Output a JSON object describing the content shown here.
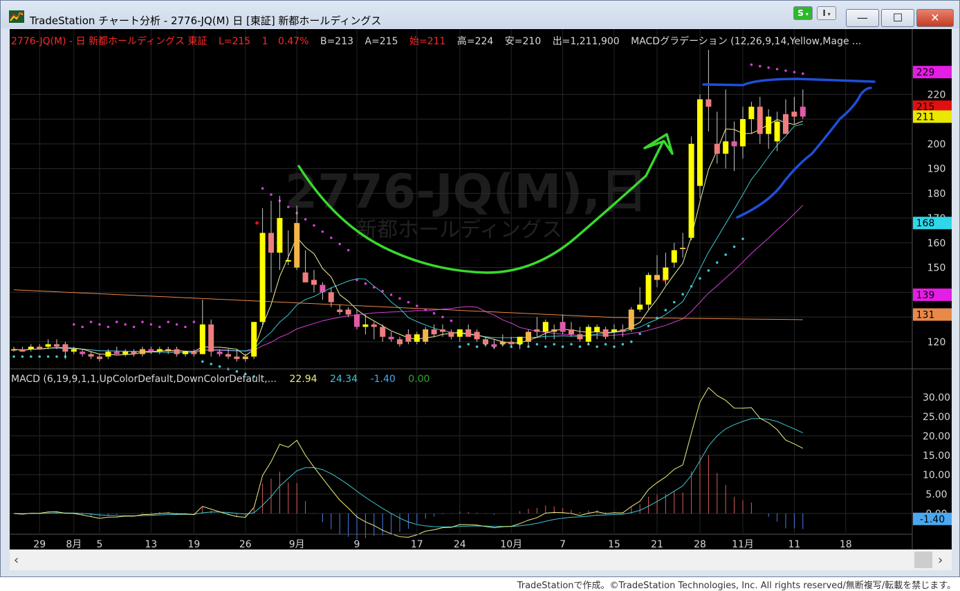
{
  "window": {
    "title": "TradeStation チャート分析 - 2776-JQ(M) 日 [東証] 新都ホールディングス",
    "btn_s": "S",
    "btn_i": "I",
    "min_glyph": "—",
    "max_glyph": "☐",
    "close_glyph": "✕"
  },
  "colors": {
    "background": "#000000",
    "bull": "#ffff00",
    "bull_alt": "#f4b64b",
    "bear": "#ef7d7d",
    "bear_alt": "#e05aa8",
    "ma_fast": "#f5f5a0",
    "ma_mid": "#3fc8d4",
    "ma_slow": "#d63fd6",
    "ma_long": "#e8894a",
    "macd": "#f0f080",
    "signal": "#3fc8d4",
    "annot_green": "#39d82e",
    "annot_blue": "#1f4fd8"
  },
  "info_bar": {
    "symbol": "2776-JQ(M) - 日  新都ホールディングス  東証",
    "last": "L=215",
    "change": "1",
    "pct": "0.47%",
    "bid": "B=213",
    "ask": "A=215",
    "open": "始=211",
    "high": "高=224",
    "low": "安=210",
    "volume": "出=1,211,900",
    "study": "MACDグラデーション (12,26,9,14,Yellow,Mage ..."
  },
  "watermark": {
    "symbol": "2776-JQ(M),日",
    "name": "新都ホールディングス"
  },
  "macd_info": {
    "label": "MACD (6,19,9,1,1,UpColorDefault,DownColorDefault,...",
    "macd": "22.94",
    "signal": "24.34",
    "hist": "-1.40",
    "zero": "0.00"
  },
  "price_badges": [
    {
      "value": "229",
      "bg": "#e41ee4",
      "fg": "#000000"
    },
    {
      "value": "215",
      "bg": "#e01010",
      "fg": "#000000"
    },
    {
      "value": "211",
      "bg": "#e8e800",
      "fg": "#000000"
    },
    {
      "value": "168",
      "bg": "#2fd8e8",
      "fg": "#000000"
    },
    {
      "value": "139",
      "bg": "#e41ee4",
      "fg": "#000000"
    },
    {
      "value": "131",
      "bg": "#e8894a",
      "fg": "#000000"
    }
  ],
  "macd_badge": {
    "value": "-1.40",
    "bg": "#4aa8f0",
    "fg": "#000000"
  },
  "chart_data": {
    "type": "candlestick",
    "price_axis": {
      "ticks": [
        120,
        130,
        140,
        150,
        160,
        170,
        180,
        190,
        200,
        210,
        220
      ],
      "ylim": [
        111,
        238
      ]
    },
    "macd_axis": {
      "ticks": [
        0,
        5,
        10,
        15,
        20,
        25,
        30
      ],
      "tick_labels": [
        "0.00",
        "5.00",
        "10.00",
        "15.00",
        "20.00",
        "25.00",
        "30.00"
      ],
      "ylim": [
        -5,
        33
      ]
    },
    "x_labels": [
      "29",
      "8月",
      "5",
      "13",
      "19",
      "26",
      "9月",
      "9",
      "17",
      "24",
      "10月",
      "7",
      "15",
      "21",
      "28",
      "11月",
      "11",
      "18"
    ],
    "candles": [
      [
        117,
        118,
        116,
        117
      ],
      [
        117,
        118,
        116,
        116
      ],
      [
        117,
        119,
        116,
        118
      ],
      [
        118,
        119,
        117,
        117
      ],
      [
        118,
        121,
        117,
        119
      ],
      [
        119,
        121,
        117,
        118
      ],
      [
        119,
        120,
        113,
        116
      ],
      [
        116,
        118,
        115,
        117
      ],
      [
        116,
        117,
        114,
        115
      ],
      [
        115,
        116,
        113,
        114
      ],
      [
        114,
        115,
        112,
        113
      ],
      [
        114,
        117,
        113,
        116
      ],
      [
        116,
        118,
        115,
        115
      ],
      [
        115,
        117,
        114,
        116
      ],
      [
        116,
        117,
        114,
        115
      ],
      [
        115,
        118,
        114,
        117
      ],
      [
        117,
        118,
        115,
        116
      ],
      [
        116,
        118,
        115,
        117
      ],
      [
        117,
        118,
        115,
        117
      ],
      [
        117,
        118,
        114,
        115
      ],
      [
        115,
        116,
        114,
        116
      ],
      [
        116,
        117,
        114,
        115
      ],
      [
        115,
        137,
        115,
        127
      ],
      [
        127,
        129,
        114,
        116
      ],
      [
        116,
        117,
        114,
        115
      ],
      [
        115,
        117,
        113,
        114
      ],
      [
        114,
        117,
        112,
        113
      ],
      [
        113,
        115,
        112,
        114
      ],
      [
        114,
        128,
        113,
        128
      ],
      [
        128,
        174,
        126,
        164
      ],
      [
        164,
        177,
        140,
        156
      ],
      [
        156,
        179,
        149,
        170
      ],
      [
        153,
        165,
        151,
        153
      ],
      [
        150,
        175,
        149,
        168
      ],
      [
        148,
        157,
        145,
        144
      ],
      [
        145,
        149,
        140,
        143
      ],
      [
        143,
        144,
        137,
        140
      ],
      [
        140,
        142,
        134,
        136
      ],
      [
        133,
        135,
        131,
        132
      ],
      [
        133,
        134,
        130,
        131
      ],
      [
        131,
        133,
        125,
        126
      ],
      [
        126,
        131,
        123,
        127
      ],
      [
        127,
        128,
        121,
        126
      ],
      [
        126,
        127,
        120,
        122
      ],
      [
        122,
        124,
        120,
        121
      ],
      [
        121,
        122,
        118,
        119
      ],
      [
        123,
        125,
        119,
        120
      ],
      [
        120,
        124,
        119,
        123
      ],
      [
        120,
        126,
        119,
        125
      ],
      [
        125,
        127,
        122,
        123
      ],
      [
        125,
        127,
        122,
        124
      ],
      [
        124,
        125,
        121,
        122
      ],
      [
        122,
        125,
        120,
        125
      ],
      [
        125,
        127,
        122,
        122
      ],
      [
        124,
        125,
        120,
        121
      ],
      [
        121,
        122,
        118,
        119
      ],
      [
        119,
        121,
        117,
        118
      ],
      [
        119,
        123,
        118,
        120
      ],
      [
        120,
        122,
        118,
        119
      ],
      [
        119,
        122,
        117,
        122
      ],
      [
        120,
        125,
        118,
        124
      ],
      [
        125,
        130,
        122,
        124
      ],
      [
        124,
        129,
        121,
        128
      ],
      [
        124,
        127,
        121,
        125
      ],
      [
        128,
        131,
        123,
        124
      ],
      [
        125,
        128,
        122,
        123
      ],
      [
        123,
        126,
        120,
        121
      ],
      [
        120,
        127,
        119,
        126
      ],
      [
        124,
        127,
        121,
        126
      ],
      [
        125,
        126,
        121,
        122
      ],
      [
        124,
        127,
        121,
        125
      ],
      [
        125,
        127,
        122,
        124
      ],
      [
        125,
        134,
        124,
        133
      ],
      [
        133,
        142,
        132,
        135
      ],
      [
        135,
        148,
        133,
        147
      ],
      [
        145,
        155,
        142,
        147
      ],
      [
        145,
        156,
        143,
        150
      ],
      [
        152,
        160,
        150,
        157
      ],
      [
        158,
        164,
        154,
        158
      ],
      [
        162,
        203,
        161,
        200
      ],
      [
        183,
        220,
        178,
        218
      ],
      [
        218,
        238,
        205,
        215
      ],
      [
        200,
        213,
        192,
        196
      ],
      [
        196,
        222,
        190,
        201
      ],
      [
        201,
        209,
        189,
        199
      ],
      [
        199,
        215,
        194,
        210
      ],
      [
        210,
        217,
        204,
        215
      ],
      [
        215,
        219,
        200,
        204
      ],
      [
        204,
        214,
        198,
        211
      ],
      [
        201,
        213,
        197,
        209
      ],
      [
        212,
        218,
        206,
        204
      ],
      [
        213,
        219,
        208,
        211
      ],
      [
        215,
        222,
        210,
        211
      ]
    ]
  }
}
